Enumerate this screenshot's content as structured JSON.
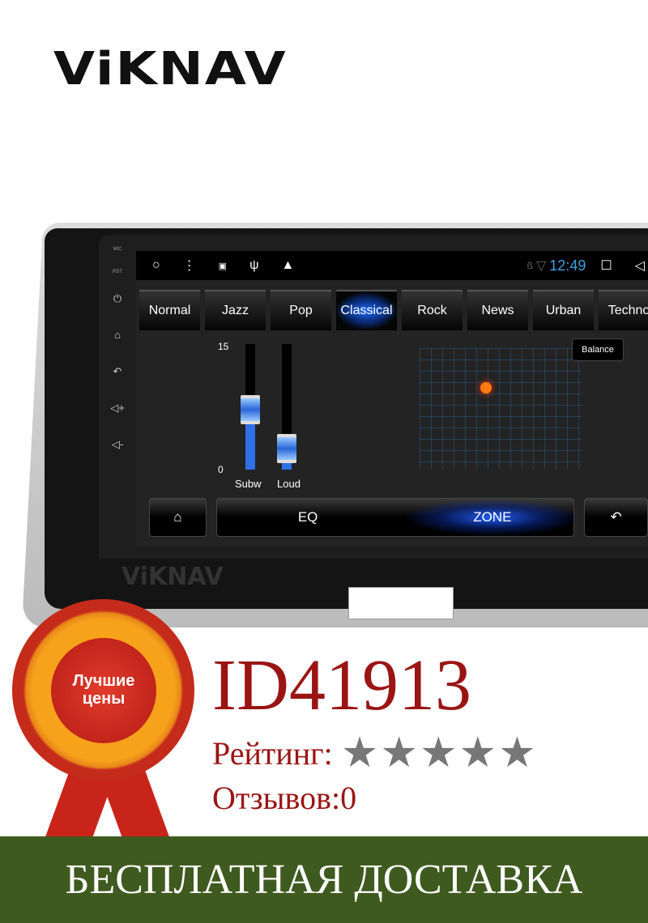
{
  "brand": {
    "logo": "ViKNAV",
    "watermark": "ViKNAV"
  },
  "device": {
    "side_labels": {
      "mic": "MIC",
      "rst": "RST"
    },
    "side_icons": [
      "power-icon",
      "home-icon",
      "back-icon",
      "volume-up-icon",
      "volume-down-icon"
    ],
    "status_bar": {
      "time": "12:49",
      "icons": [
        "circle-icon",
        "menu-dots-icon",
        "image-icon",
        "usb-icon",
        "warning-icon",
        "bluetooth-icon",
        "wifi-icon",
        "recent-apps-icon",
        "back-nav-icon"
      ],
      "time_color": "#3aa3e0"
    },
    "presets": [
      {
        "label": "Normal"
      },
      {
        "label": "Jazz"
      },
      {
        "label": "Pop"
      },
      {
        "label": "Classical",
        "active": true
      },
      {
        "label": "Rock"
      },
      {
        "label": "News"
      },
      {
        "label": "Urban"
      },
      {
        "label": "Techno"
      }
    ],
    "sliders": {
      "max_label": "15",
      "min_label": "0",
      "items": [
        {
          "label": "Subw",
          "value": 7
        },
        {
          "label": "Loud",
          "value": 1
        }
      ]
    },
    "balance_label": "Balance",
    "bottom": {
      "eq": "EQ",
      "zone": "ZONE",
      "zone_active": true
    },
    "accent": "#2a7cff"
  },
  "medal": {
    "text_line1": "Лучшие",
    "text_line2": "цены"
  },
  "product": {
    "id": "ID41913",
    "rating_label": "Рейтинг:",
    "stars": 5,
    "stars_filled": 0,
    "star_glyphs": "★★★★★",
    "reviews": "Отзывов:0"
  },
  "banner": {
    "text": "БЕСПЛАТНАЯ ДОСТАВКА",
    "color": "#3f5a1f"
  }
}
